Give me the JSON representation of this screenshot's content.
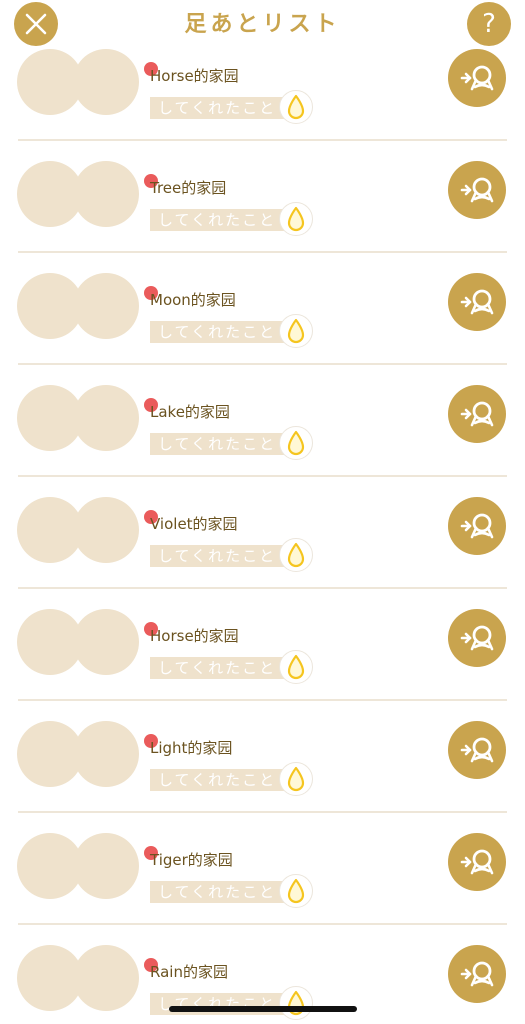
{
  "header": {
    "title": "足あとリスト",
    "close_icon": "close-icon",
    "help_label": "?"
  },
  "rows": [
    {
      "name": "Horse的家园",
      "action": "してくれたこと"
    },
    {
      "name": "Tree的家园",
      "action": "してくれたこと"
    },
    {
      "name": "Moon的家园",
      "action": "してくれたこと"
    },
    {
      "name": "Lake的家园",
      "action": "してくれたこと"
    },
    {
      "name": "Violet的家园",
      "action": "してくれたこと"
    },
    {
      "name": "Horse的家园",
      "action": "してくれたこと"
    },
    {
      "name": "Light的家园",
      "action": "してくれたこと"
    },
    {
      "name": "Tiger的家园",
      "action": "してくれたこと"
    },
    {
      "name": "Rain的家园",
      "action": "してくれたこと"
    }
  ],
  "colors": {
    "accent": "#c9a44e",
    "avatar_placeholder": "#efe2cc",
    "new_dot": "#ea5b5b",
    "name_text": "#6b5320",
    "drop_fill": "#f5c51f"
  },
  "icons": {
    "drop": "water-drop-icon",
    "visit": "visit-home-icon"
  }
}
